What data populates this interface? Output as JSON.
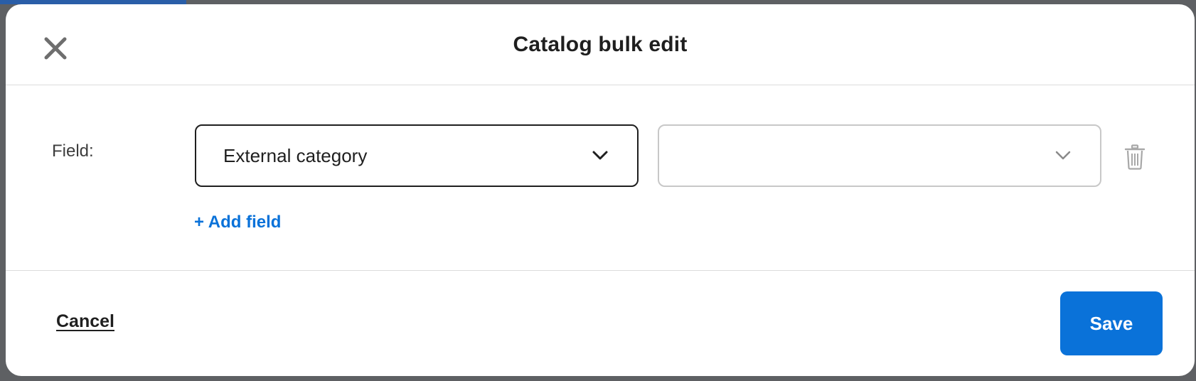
{
  "dialog": {
    "title": "Catalog bulk edit",
    "close_icon": "close-icon"
  },
  "form": {
    "field_label": "Field:",
    "field_select": {
      "value": "External category",
      "icon": "chevron-down-icon"
    },
    "value_select": {
      "value": "",
      "icon": "chevron-down-icon"
    },
    "delete_icon": "trash-icon",
    "add_field_label": "+ Add field"
  },
  "footer": {
    "cancel_label": "Cancel",
    "save_label": "Save"
  },
  "colors": {
    "accent": "#0a72d9",
    "text": "#1f1f1f",
    "border_muted": "#c8c8c8"
  }
}
